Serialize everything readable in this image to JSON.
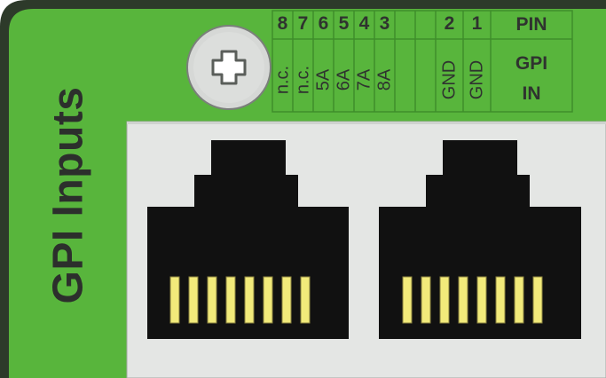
{
  "panel": {
    "title": "GPI Inputs",
    "colors": {
      "panel_green": "#58b53c",
      "grid_line": "#3f8e2b",
      "connector_body": "#111111",
      "contact": "#f2ea7a",
      "inset": "#e4e6e4"
    }
  },
  "pin_table": {
    "header": {
      "row1": "PIN",
      "row2a": "GPI",
      "row2b": "IN"
    },
    "pins": [
      {
        "num": "8",
        "label": "n.c."
      },
      {
        "num": "7",
        "label": "n.c."
      },
      {
        "num": "6",
        "label": "5A"
      },
      {
        "num": "5",
        "label": "6A"
      },
      {
        "num": "4",
        "label": "7A"
      },
      {
        "num": "3",
        "label": "8A"
      },
      {
        "num": "2",
        "label": "GND"
      },
      {
        "num": "1",
        "label": "GND"
      }
    ]
  },
  "screw": {
    "icon": "phillips-screw-icon"
  },
  "connectors": [
    {
      "name": "RJ45 port 1",
      "contacts": 8
    },
    {
      "name": "RJ45 port 2",
      "contacts": 8
    }
  ]
}
